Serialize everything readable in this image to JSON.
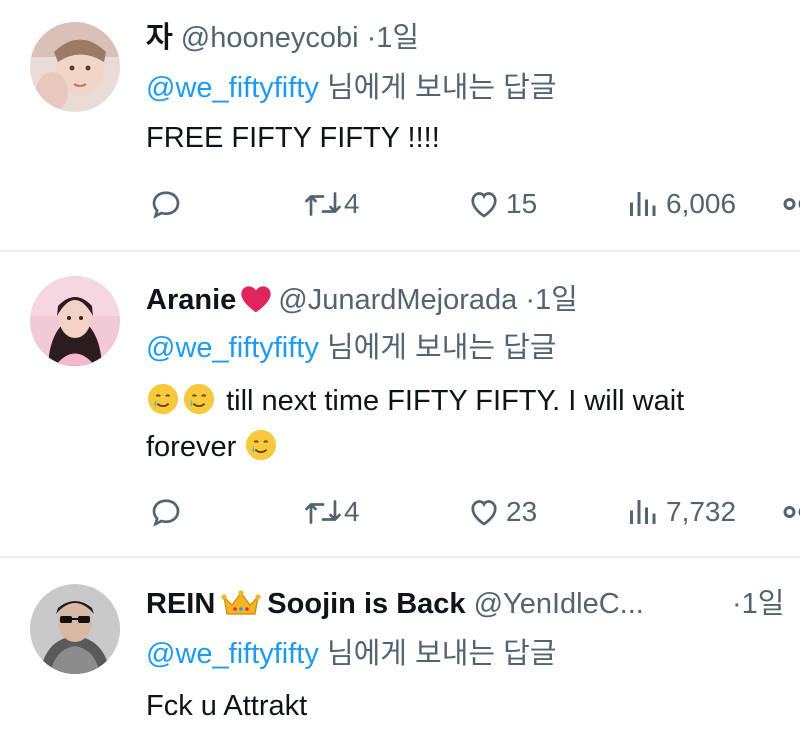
{
  "tweets": [
    {
      "name": "자",
      "handle": "@hooneycobi",
      "sep": "·",
      "time": "1일",
      "reply_mention": "@we_fiftyfifty",
      "reply_suffix": "님에게 보내는 답글",
      "text": "FREE FIFTY FIFTY !!!!",
      "retweets": "4",
      "likes": "15",
      "views": "6,006"
    },
    {
      "name": "Aranie",
      "handle": "@JunardMejorada",
      "sep": "·",
      "time": "1일",
      "reply_mention": "@we_fiftyfifty",
      "reply_suffix": "님에게 보내는 답글",
      "text_line1": "till next time FIFTY FIFTY. I will wait",
      "text_line2": "forever",
      "retweets": "4",
      "likes": "23",
      "views": "7,732"
    },
    {
      "name_part1": "REIN",
      "name_part2": "Soojin is Back",
      "handle": "@YenIdleC...",
      "sep": "·",
      "time": "1일",
      "reply_mention": "@we_fiftyfifty",
      "reply_suffix": "님에게 보내는 답글",
      "text": "Fck u Attrakt"
    }
  ],
  "icons": {
    "reply": "reply-bubble-icon",
    "retweet": "retweet-icon",
    "like": "heart-outline-icon",
    "views": "views-bar-icon",
    "share": "share-icon",
    "name_heart": "red-heart-emoji",
    "name_crown": "crown-emoji",
    "tear_smile": "smiling-face-with-tear-emoji"
  },
  "colors": {
    "mention": "#1d9bf0",
    "secondary": "#536471",
    "primary": "#0f1419",
    "divider": "#eceff1"
  }
}
